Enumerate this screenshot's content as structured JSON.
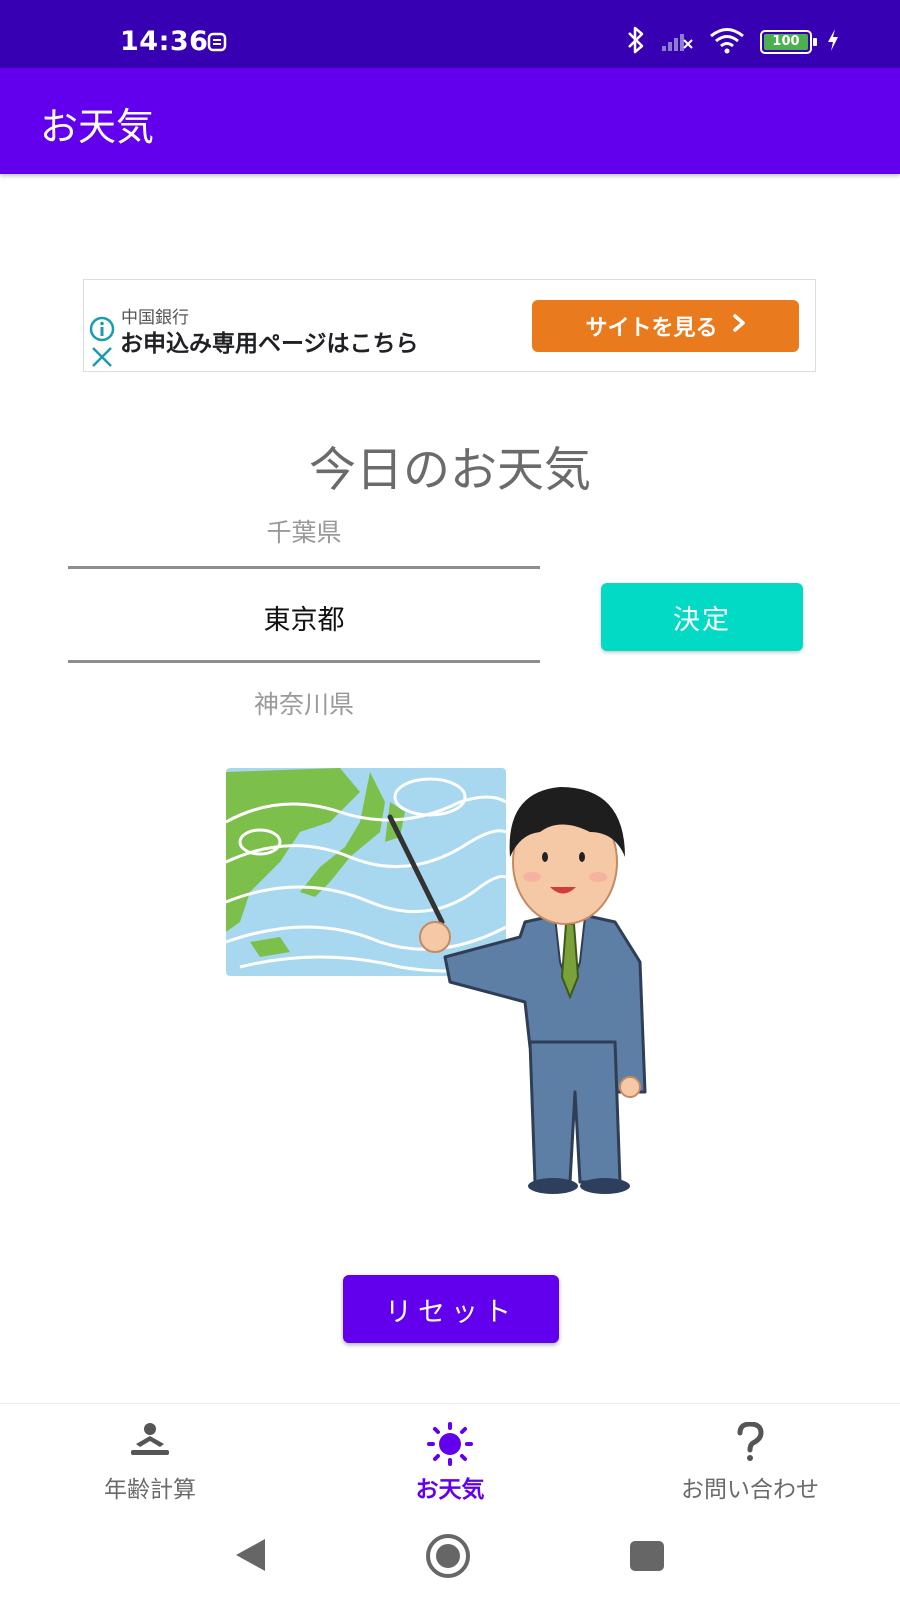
{
  "status_bar": {
    "time": "14:36",
    "battery": "100",
    "icons": [
      "alarm-icon",
      "bluetooth-icon",
      "signal-off-icon",
      "wifi-icon",
      "battery-icon",
      "charging-icon"
    ]
  },
  "app_bar": {
    "title": "お天気"
  },
  "ad": {
    "advertiser": "中国銀行",
    "headline": "お申込み専用ページはこちら",
    "cta_label": "サイトを見る",
    "cta_color": "#ea7a1e"
  },
  "weather": {
    "heading": "今日のお天気",
    "picker": {
      "previous": "千葉県",
      "selected": "東京都",
      "next": "神奈川県"
    },
    "decide_label": "決定",
    "reset_label": "リセット"
  },
  "bottom_nav": {
    "items": [
      {
        "label": "年齢計算",
        "icon": "age-person-icon",
        "active": false
      },
      {
        "label": "お天気",
        "icon": "sun-icon",
        "active": true
      },
      {
        "label": "お問い合わせ",
        "icon": "question-icon",
        "active": false
      }
    ]
  },
  "colors": {
    "status_bar": "#3700b3",
    "primary": "#6200ee",
    "accent": "#03dac5"
  }
}
